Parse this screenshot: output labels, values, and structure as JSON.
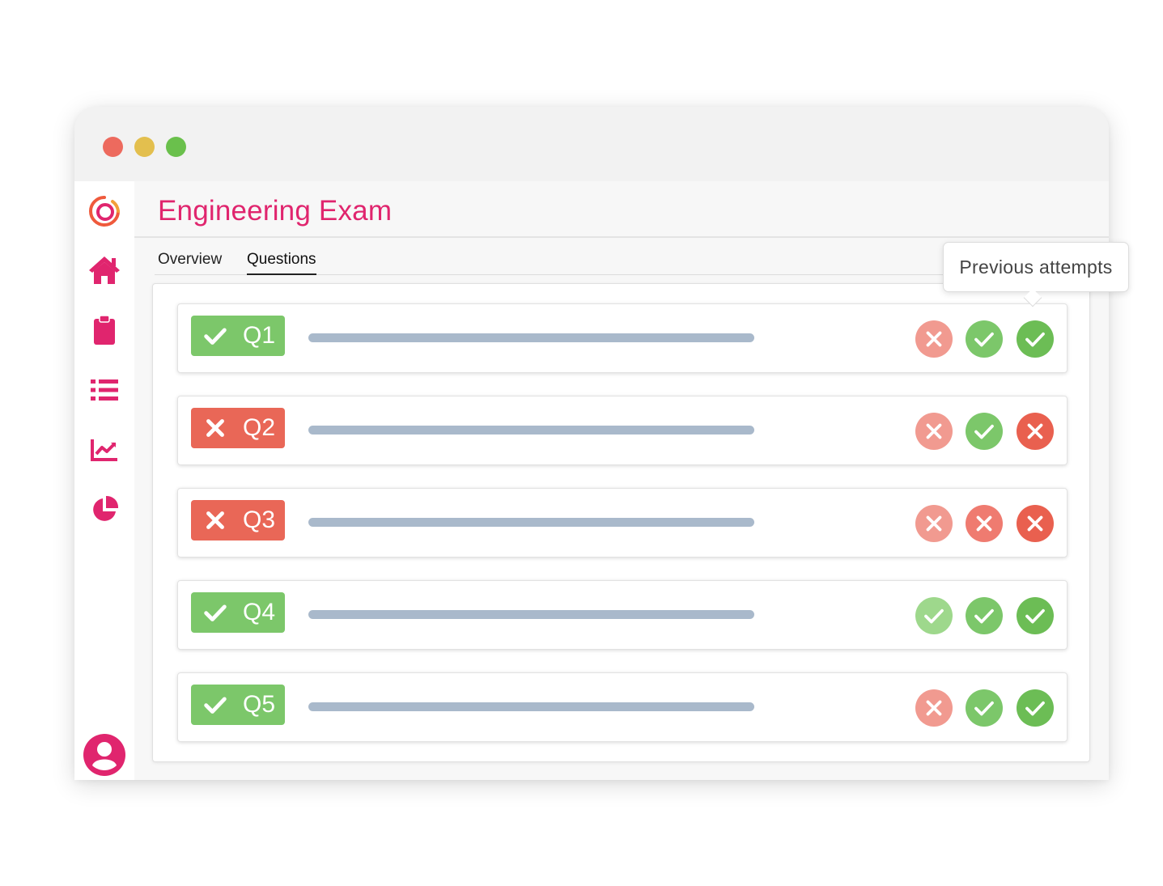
{
  "window": {
    "controls": [
      "close",
      "minimize",
      "maximize"
    ]
  },
  "sidebar": {
    "items": [
      {
        "name": "logo",
        "icon": "logo-ring-icon"
      },
      {
        "name": "home",
        "icon": "home-icon"
      },
      {
        "name": "exams",
        "icon": "clipboard-icon"
      },
      {
        "name": "list",
        "icon": "list-icon"
      },
      {
        "name": "analytics",
        "icon": "line-chart-icon"
      },
      {
        "name": "reports",
        "icon": "pie-chart-icon"
      },
      {
        "name": "profile",
        "icon": "user-avatar-icon"
      }
    ],
    "accent_color": "#e0256e"
  },
  "header": {
    "title": "Engineering Exam"
  },
  "tabs": [
    {
      "label": "Overview",
      "active": false
    },
    {
      "label": "Questions",
      "active": true
    }
  ],
  "tooltip": {
    "text": "Previous attempts"
  },
  "status_colors": {
    "correct": "#7cc76a",
    "wrong": "#e96757"
  },
  "questions": [
    {
      "label": "Q1",
      "status": "correct",
      "attempts": [
        "wrong",
        "correct",
        "correct"
      ]
    },
    {
      "label": "Q2",
      "status": "wrong",
      "attempts": [
        "wrong",
        "correct",
        "wrong"
      ]
    },
    {
      "label": "Q3",
      "status": "wrong",
      "attempts": [
        "wrong",
        "wrong",
        "wrong"
      ]
    },
    {
      "label": "Q4",
      "status": "correct",
      "attempts": [
        "correct",
        "correct",
        "correct"
      ]
    },
    {
      "label": "Q5",
      "status": "correct",
      "attempts": [
        "wrong",
        "correct",
        "correct"
      ]
    }
  ]
}
